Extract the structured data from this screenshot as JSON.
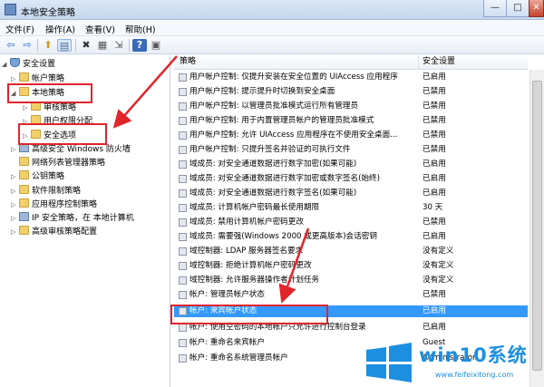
{
  "window": {
    "title": "本地安全策略",
    "min_label": "—",
    "max_label": "□",
    "close_label": "✕"
  },
  "menu": [
    "文件(F)",
    "操作(A)",
    "查看(V)",
    "帮助(H)"
  ],
  "toolbar": {
    "back": "⇦",
    "forward": "⇨",
    "up": "⬆",
    "tree": "▤",
    "delete": "✖",
    "props": "▦",
    "export": "⇲",
    "help": "?",
    "view": "▣"
  },
  "tree": [
    {
      "label": "安全设置",
      "icon": "shield",
      "exp": "◢"
    },
    {
      "label": "帐户策略",
      "icon": "folder",
      "exp": "▷"
    },
    {
      "label": "本地策略",
      "icon": "folder",
      "exp": "◢"
    },
    {
      "label": "审核策略",
      "icon": "folder",
      "exp": "▷"
    },
    {
      "label": "用户权限分配",
      "icon": "folder",
      "exp": "▷"
    },
    {
      "label": "安全选项",
      "icon": "folder",
      "exp": "▷"
    },
    {
      "label": "高级安全 Windows 防火墙",
      "icon": "comp",
      "exp": "▷"
    },
    {
      "label": "网络列表管理器策略",
      "icon": "folder",
      "exp": ""
    },
    {
      "label": "公钥策略",
      "icon": "folder",
      "exp": "▷"
    },
    {
      "label": "软件限制策略",
      "icon": "folder",
      "exp": "▷"
    },
    {
      "label": "应用程序控制策略",
      "icon": "folder",
      "exp": "▷"
    },
    {
      "label": "IP 安全策略，在 本地计算机",
      "icon": "comp",
      "exp": "▷"
    },
    {
      "label": "高级审核策略配置",
      "icon": "folder",
      "exp": "▷"
    }
  ],
  "list": {
    "col_policy": "策略",
    "col_setting": "安全设置",
    "rows": [
      {
        "name": "用户帐户控制: 仅提升安装在安全位置的 UIAccess 应用程序",
        "value": "已启用"
      },
      {
        "name": "用户帐户控制: 提示提升时切换到安全桌面",
        "value": "已禁用"
      },
      {
        "name": "用户帐户控制: 以管理员批准模式运行所有管理员",
        "value": "已禁用"
      },
      {
        "name": "用户帐户控制: 用于内置管理员帐户的管理员批准模式",
        "value": "已禁用"
      },
      {
        "name": "用户帐户控制: 允许 UIAccess 应用程序在不使用安全桌面...",
        "value": "已禁用"
      },
      {
        "name": "用户帐户控制: 只提升签名并验证的可执行文件",
        "value": "已禁用"
      },
      {
        "name": "域成员: 对安全通道数据进行数字加密(如果可能)",
        "value": "已启用"
      },
      {
        "name": "域成员: 对安全通道数据进行数字加密或数字签名(始终)",
        "value": "已启用"
      },
      {
        "name": "域成员: 对安全通道数据进行数字签名(如果可能)",
        "value": "已启用"
      },
      {
        "name": "域成员: 计算机帐户密码最长使用期限",
        "value": "30 天"
      },
      {
        "name": "域成员: 禁用计算机帐户密码更改",
        "value": "已禁用"
      },
      {
        "name": "域成员: 需要强(Windows 2000 或更高版本)会话密钥",
        "value": "已启用"
      },
      {
        "name": "域控制器: LDAP 服务器签名要求",
        "value": "没有定义"
      },
      {
        "name": "域控制器: 拒绝计算机帐户密码更改",
        "value": "没有定义"
      },
      {
        "name": "域控制器: 允许服务器操作者计划任务",
        "value": "没有定义"
      },
      {
        "name": "帐户: 管理员帐户状态",
        "value": "已禁用"
      },
      {
        "name": "帐户: 来宾帐户状态",
        "value": "已启用"
      },
      {
        "name": "帐户: 使用空密码的本地帐户只允许进行控制台登录",
        "value": "已启用"
      },
      {
        "name": "帐户: 重命名来宾帐户",
        "value": "Guest"
      },
      {
        "name": "帐户: 重命名系统管理员帐户",
        "value": "Administrator"
      }
    ]
  },
  "watermark": {
    "name": "win10系统",
    "url": "www.feifeixitong.com"
  },
  "colors": {
    "selection": "#3399ff",
    "highlight": "#e0252b",
    "watermark": "#1d8fe0"
  }
}
